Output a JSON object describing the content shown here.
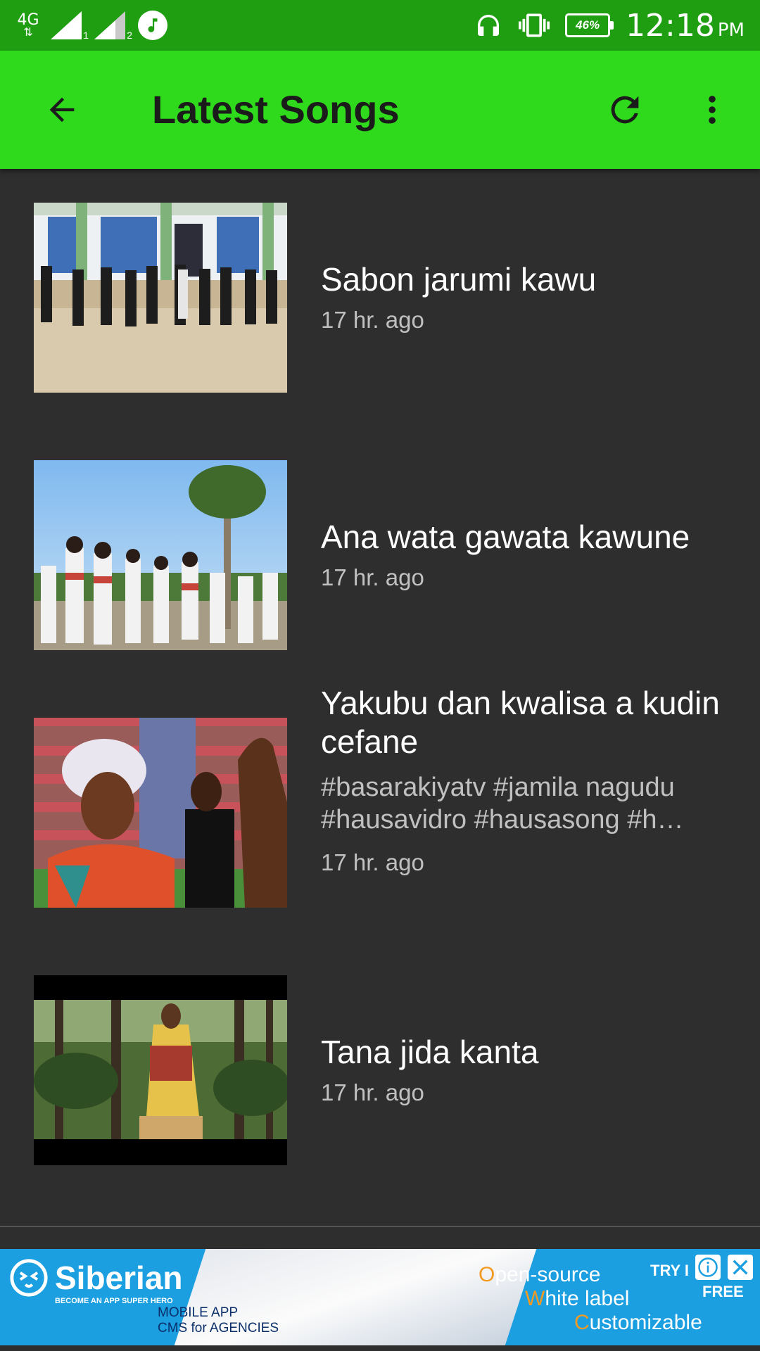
{
  "status_bar": {
    "network": "4G",
    "sim1": "1",
    "sim2": "2",
    "battery": "46%",
    "time": "12:18",
    "ampm": "PM",
    "icons": [
      "signal-icon",
      "music-note-icon",
      "headphones-icon",
      "vibrate-icon",
      "battery-icon"
    ]
  },
  "appbar": {
    "title": "Latest Songs",
    "back_icon": "arrow-back-icon",
    "refresh_icon": "refresh-icon",
    "menu_icon": "more-vert-icon",
    "color": "#2fd91b"
  },
  "songs": [
    {
      "title": "Sabon jarumi kawu",
      "description": "",
      "time": "17 hr. ago"
    },
    {
      "title": "Ana wata gawata kawune",
      "description": "",
      "time": "17 hr. ago"
    },
    {
      "title": "Yakubu dan kwalisa a kudin cefane",
      "description": "#basarakiyatv #jamila nagudu #hausavidro #hausasong #h…",
      "time": "17 hr. ago"
    },
    {
      "title": "Tana jida kanta",
      "description": "",
      "time": "17 hr. ago"
    }
  ],
  "ad": {
    "brand": "Siberian",
    "tagline": "BECOME AN APP SUPER HERO",
    "sub_line1": "MOBILE APP",
    "sub_line2": "CMS for AGENCIES",
    "feature1_first": "O",
    "feature1_rest": "pen-source",
    "feature2_first": "W",
    "feature2_rest": "hite label",
    "feature3_first": "C",
    "feature3_rest": "ustomizable",
    "try": "TRY I",
    "free": "FREE"
  }
}
